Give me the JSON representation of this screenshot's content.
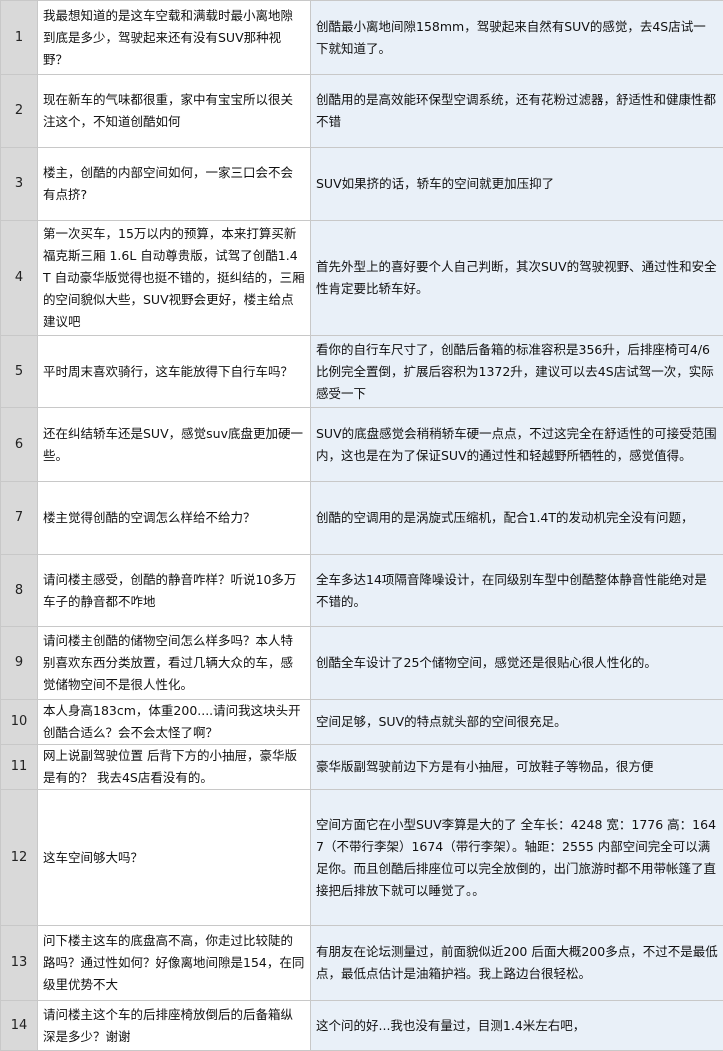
{
  "rows": [
    {
      "num": "1",
      "question": "我最想知道的是这车空载和满载时最小离地隙到底是多少，驾驶起来还有没有SUV那种视野？",
      "answer": "创酷最小离地间隙158mm，驾驶起来自然有SUV的感觉，去4S店试一下就知道了。"
    },
    {
      "num": "2",
      "question": "现在新车的气味都很重，家中有宝宝所以很关注这个，不知道创酷如何",
      "answer": "创酷用的是高效能环保型空调系统，还有花粉过滤器，舒适性和健康性都不错"
    },
    {
      "num": "3",
      "question": "楼主，创酷的内部空间如何，一家三口会不会有点挤?",
      "answer": "SUV如果挤的话，轿车的空间就更加压抑了"
    },
    {
      "num": "4",
      "question": " 第一次买车，15万以内的预算，本来打算买新福克斯三厢 1.6L 自动尊贵版，试驾了创酷1.4T 自动豪华版觉得也挺不错的，挺纠结的，三厢的空间貌似大些，SUV视野会更好，楼主给点建议吧",
      "answer": "首先外型上的喜好要个人自己判断，其次SUV的驾驶视野、通过性和安全性肯定要比轿车好。"
    },
    {
      "num": "5",
      "question": "平时周末喜欢骑行，这车能放得下自行车吗？",
      "answer": "看你的自行车尺寸了，创酷后备箱的标准容积是356升，后排座椅可4/6比例完全置倒，扩展后容积为1372升，建议可以去4S店试驾一次，实际感受一下"
    },
    {
      "num": "6",
      "question": "还在纠结轿车还是SUV，感觉suv底盘更加硬一些。",
      "answer": "SUV的底盘感觉会稍稍轿车硬一点点，不过这完全在舒适性的可接受范围内，这也是在为了保证SUV的通过性和轻越野所牺牲的，感觉值得。"
    },
    {
      "num": "7",
      "question": "楼主觉得创酷的空调怎么样给不给力？",
      "answer": "创酷的空调用的是涡旋式压缩机，配合1.4T的发动机完全没有问题，"
    },
    {
      "num": "8",
      "question": "请问楼主感受，创酷的静音咋样？听说10多万车子的静音都不咋地",
      "answer": "全车多达14项隔音降噪设计，在同级别车型中创酷整体静音性能绝对是不错的。"
    },
    {
      "num": "9",
      "question": "请问楼主创酷的储物空间怎么样多吗？本人特别喜欢东西分类放置，看过几辆大众的车，感觉储物空间不是很人性化。",
      "answer": "  创酷全车设计了25个储物空间，感觉还是很贴心很人性化的。"
    },
    {
      "num": "10",
      "question": "本人身高183cm，体重200....请问我这块头开创酷合适么？会不会太怪了啊？",
      "answer": "空间足够，SUV的特点就头部的空间很充足。"
    },
    {
      "num": "11",
      "question": "网上说副驾驶位置 后背下方的小抽屉，豪华版是有的？ 我去4S店看没有的。",
      "answer": "豪华版副驾驶前边下方是有小抽屉，可放鞋子等物品，很方便"
    },
    {
      "num": "12",
      "question": "这车空间够大吗？",
      "answer": "空间方面它在小型SUV李算是大的了 全车长：4248 宽：1776 高：1647（不带行李架）1674（带行李架）。轴距：2555 内部空间完全可以满足你。而且创酷后排座位可以完全放倒的，出门旅游时都不用带帐篷了直接把后排放下就可以睡觉了。。"
    },
    {
      "num": "13",
      "question": "问下楼主这车的底盘高不高，你走过比较陡的路吗？通过性如何？好像离地间隙是154，在同级里优势不大",
      "answer": "有朋友在论坛测量过，前面貌似近200 后面大概200多点，不过不是最低点，最低点估计是油箱护裆。我上路边台很轻松。"
    },
    {
      "num": "14",
      "question": "请问楼主这个车的后排座椅放倒后的后备箱纵深是多少？谢谢",
      "answer": "这个问的好...我也没有量过，目测1.4米左右吧，"
    }
  ]
}
